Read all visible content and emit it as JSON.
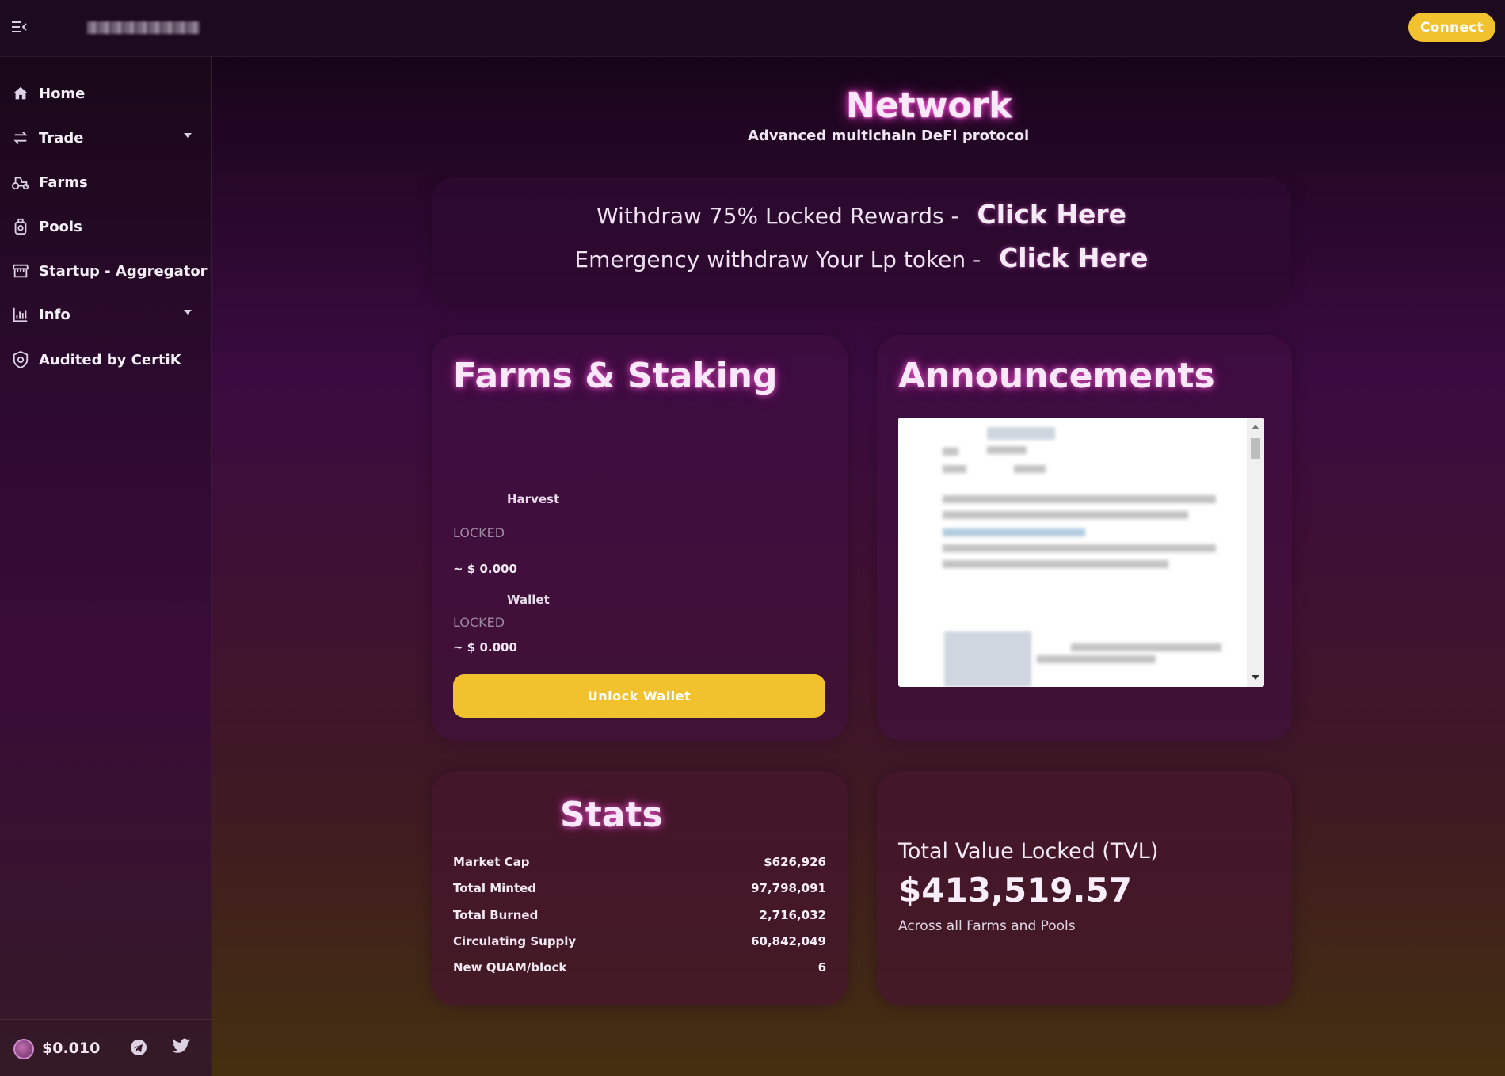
{
  "topbar": {
    "connect_label": "Connect"
  },
  "sidebar": {
    "items": [
      {
        "label": "Home",
        "icon": "home-icon"
      },
      {
        "label": "Trade",
        "icon": "swap-icon"
      },
      {
        "label": "Farms",
        "icon": "tractor-icon"
      },
      {
        "label": "Pools",
        "icon": "pool-icon"
      },
      {
        "label": "Startup - Aggregator",
        "icon": "store-icon"
      },
      {
        "label": "Info",
        "icon": "chart-icon"
      },
      {
        "label": "Audited by CertiK",
        "icon": "shield-icon"
      }
    ],
    "footer": {
      "token_price": "$0.010"
    }
  },
  "header": {
    "title": "Network",
    "subtitle": "Advanced multichain DeFi protocol"
  },
  "withdraw": {
    "row1_text": "Withdraw 75% Locked Rewards -",
    "row1_link": "Click Here",
    "row2_text": "Emergency withdraw Your Lp token -",
    "row2_link": "Click Here"
  },
  "farms": {
    "title": "Farms & Staking",
    "harvest_label": "Harvest",
    "harvest_locked": "LOCKED",
    "harvest_value": "~ $ 0.000",
    "wallet_label": "Wallet",
    "wallet_locked": "LOCKED",
    "wallet_value": "~ $ 0.000",
    "unlock_label": "Unlock Wallet"
  },
  "announcements": {
    "title": "Announcements"
  },
  "stats": {
    "title": "Stats",
    "rows": [
      {
        "label": "Market Cap",
        "value": "$626,926"
      },
      {
        "label": "Total Minted",
        "value": "97,798,091"
      },
      {
        "label": "Total Burned",
        "value": "2,716,032"
      },
      {
        "label": "Circulating Supply",
        "value": "60,842,049"
      },
      {
        "label": "New QUAM/block",
        "value": "6"
      }
    ]
  },
  "tvl": {
    "title": "Total Value Locked (TVL)",
    "value": "$413,519.57",
    "subtitle": "Across all Farms and Pools"
  },
  "colors": {
    "accent": "#f2c12e",
    "glow": "#ff4fd8"
  }
}
